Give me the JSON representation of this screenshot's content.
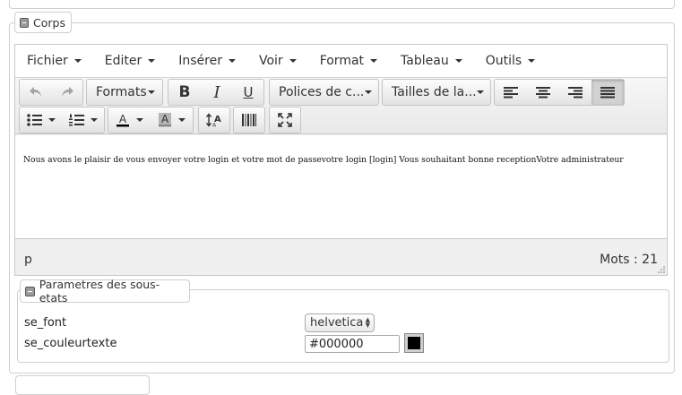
{
  "corps_fieldset": {
    "legend": "Corps"
  },
  "editor": {
    "menubar": [
      "Fichier",
      "Editer",
      "Insérer",
      "Voir",
      "Format",
      "Tableau",
      "Outils"
    ],
    "toolbar": {
      "formats_label": "Formats",
      "bold_label": "B",
      "italic_label": "I",
      "underline_label": "U",
      "font_family_label": "Polices de c...",
      "font_size_label": "Tailles de la..."
    },
    "content_text": "Nous avons le plaisir de vous envoyer votre login et votre mot de passevotre login [login] Vous souhaitant bonne receptionVotre administrateur",
    "status_path": "p",
    "word_count": "Mots : 21",
    "icons": [
      "undo-icon",
      "redo-icon",
      "align-left-icon",
      "align-center-icon",
      "align-right-icon",
      "align-justify-icon",
      "bullet-list-icon",
      "numbered-list-icon",
      "text-color-icon",
      "background-color-icon",
      "font-size-icon",
      "barcode-icon",
      "fullscreen-icon"
    ]
  },
  "params_fieldset": {
    "legend": "Parametres des sous-etats",
    "font_label": "se_font",
    "font_value": "helvetica",
    "color_label": "se_couleurtexte",
    "color_value": "#000000",
    "swatch_color": "#000000"
  },
  "colors": {
    "text_color_bar": "#000000",
    "bg_color_bar": "#888888"
  }
}
